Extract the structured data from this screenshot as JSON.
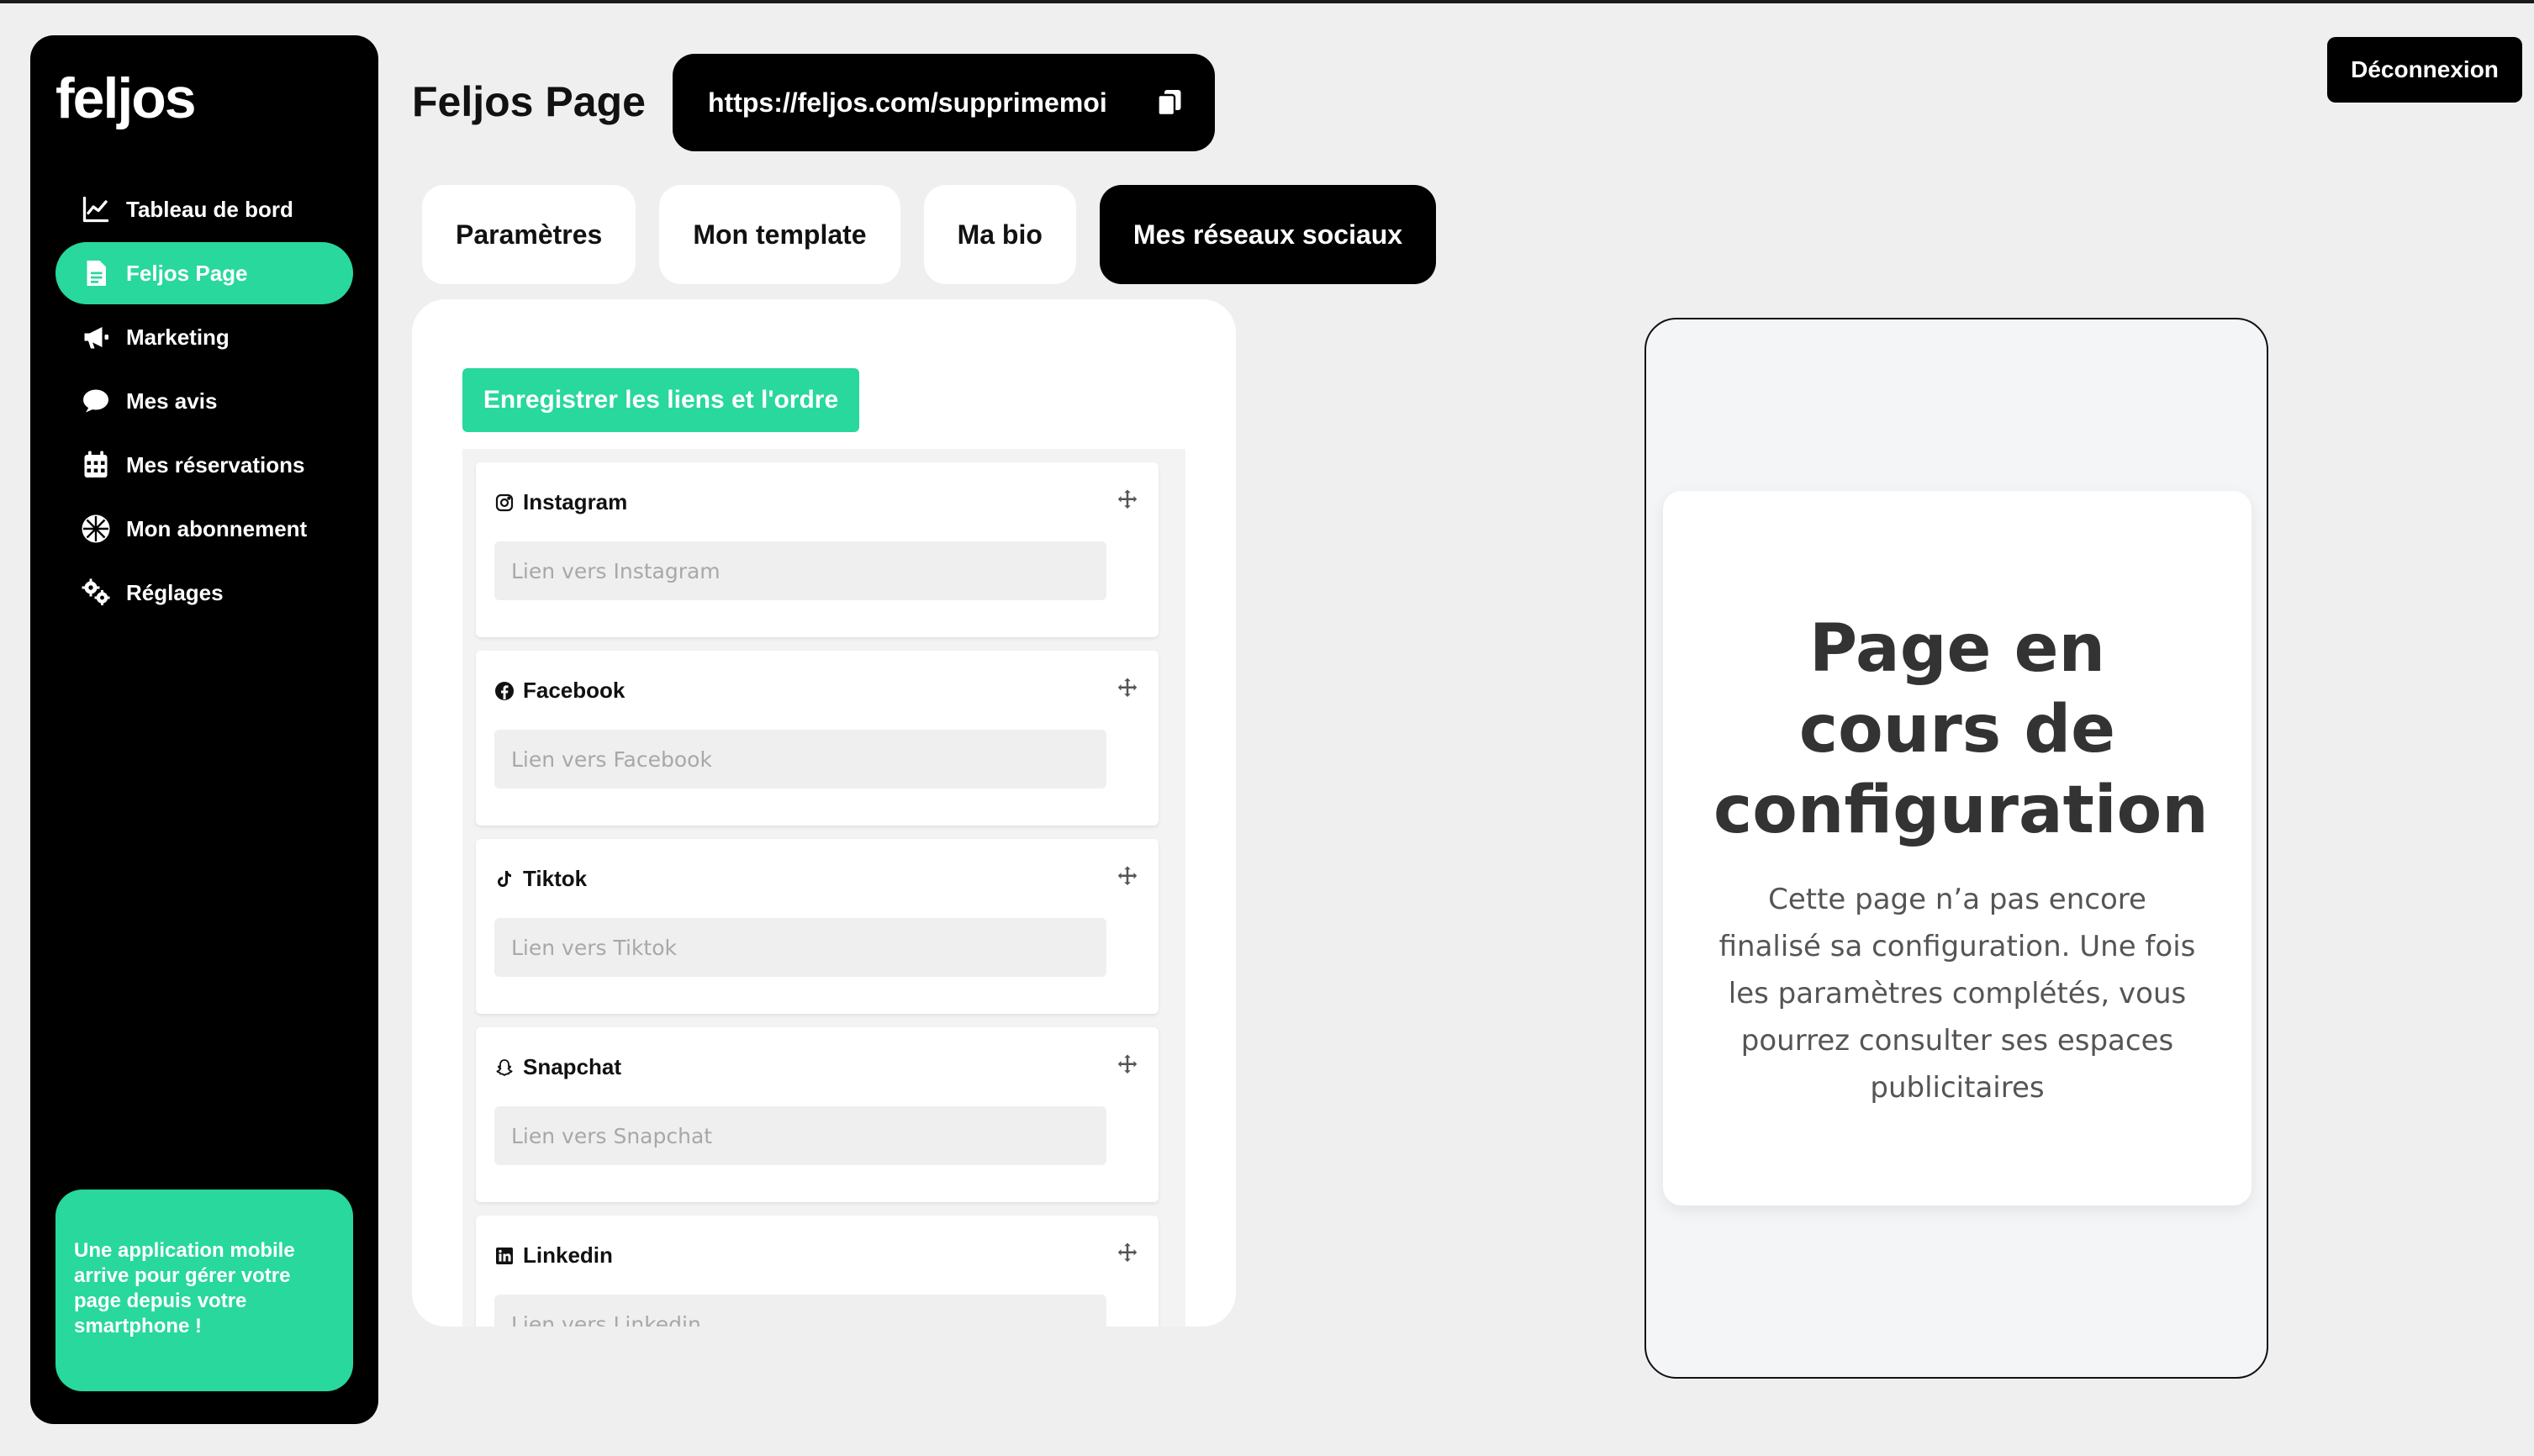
{
  "sidebar": {
    "logo": "feljos",
    "items": [
      {
        "label": "Tableau de bord",
        "icon": "chart-line-icon"
      },
      {
        "label": "Feljos Page",
        "icon": "document-icon",
        "active": true
      },
      {
        "label": "Marketing",
        "icon": "megaphone-icon"
      },
      {
        "label": "Mes avis",
        "icon": "chat-bubble-icon"
      },
      {
        "label": "Mes réservations",
        "icon": "calendar-icon"
      },
      {
        "label": "Mon abonnement",
        "icon": "ball-icon"
      },
      {
        "label": "Réglages",
        "icon": "gears-icon"
      }
    ],
    "promo": "Une application mobile arrive pour gérer votre page depuis votre smartphone !"
  },
  "header": {
    "title": "Feljos Page",
    "url": "https://feljos.com/supprimemoi",
    "logout_label": "Déconnexion"
  },
  "tabs": [
    {
      "label": "Paramètres"
    },
    {
      "label": "Mon template"
    },
    {
      "label": "Ma bio"
    },
    {
      "label": "Mes réseaux sociaux",
      "active": true
    }
  ],
  "socials": {
    "save_label": "Enregistrer les liens et l'ordre",
    "items": [
      {
        "name": "Instagram",
        "placeholder": "Lien vers Instagram",
        "value": ""
      },
      {
        "name": "Facebook",
        "placeholder": "Lien vers Facebook",
        "value": ""
      },
      {
        "name": "Tiktok",
        "placeholder": "Lien vers Tiktok",
        "value": ""
      },
      {
        "name": "Snapchat",
        "placeholder": "Lien vers Snapchat",
        "value": ""
      },
      {
        "name": "Linkedin",
        "placeholder": "Lien vers Linkedin",
        "value": ""
      }
    ]
  },
  "preview": {
    "title": "Page en cours de configuration",
    "text": "Cette page n’a pas encore finalisé sa configuration. Une fois les paramètres complétés, vous pourrez consulter ses espaces publicitaires"
  },
  "colors": {
    "accent": "#28d89c",
    "dark": "#000000",
    "background": "#efefef"
  }
}
